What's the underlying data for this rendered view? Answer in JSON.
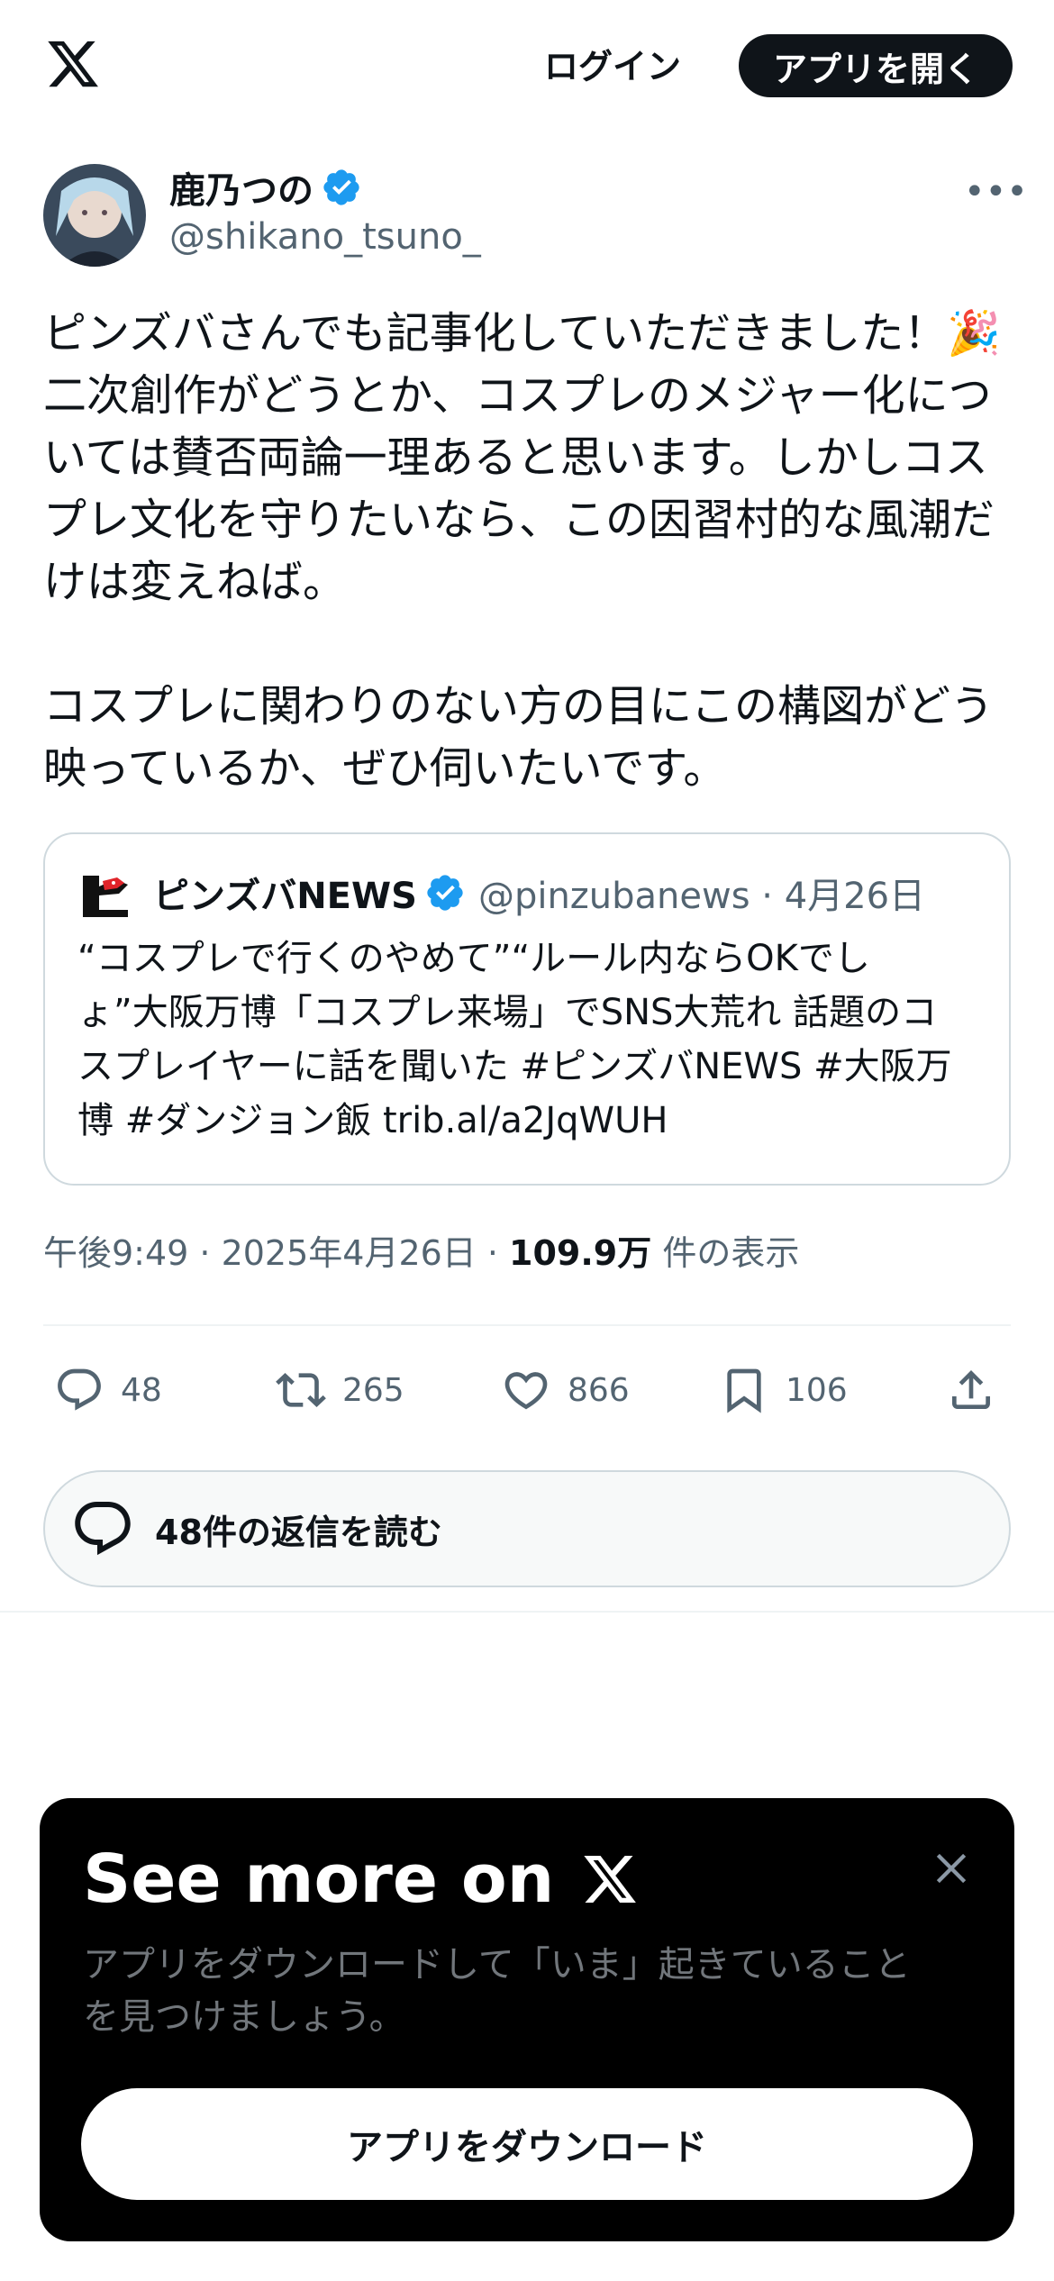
{
  "header": {
    "login_label": "ログイン",
    "open_app_label": "アプリを開く"
  },
  "tweet": {
    "author_name": "鹿乃つの",
    "author_handle": "@shikano_tsuno_",
    "more_label": "•••",
    "text_lines": [
      "ピンズバさんでも記事化していただきました！🎉",
      "二次創作がどうとか、コスプレのメジャー化につ",
      "いては賛否両論一理あると思います。しかしコス",
      "プレ文化を守りたいなら、この因習村的な風潮だ",
      "けは変えねば。",
      "",
      "コスプレに関わりのない方の目にこの構図がどう",
      "映っているか、ぜひ伺いたいです。"
    ],
    "quote": {
      "name": "ピンズバNEWS",
      "handle_date": "@pinzubanews · 4月26日",
      "text_lines": [
        "“コスプレで行くのやめて”“ルール内ならOKでし",
        "ょ”大阪万博「コスプレ来場」でSNS大荒れ 話題のコ",
        "スプレイヤーに話を聞いた #ピンズバNEWS #大阪万",
        "博 #ダンジョン飯 trib.al/a2JqWUH"
      ]
    },
    "meta": {
      "time_date": "午後9:49 · 2025年4月26日 · ",
      "views": "109.9万",
      "views_suffix": " 件の表示"
    },
    "actions": {
      "replies": "48",
      "reposts": "265",
      "likes": "866",
      "bookmarks": "106"
    },
    "read_replies_label": "48件の返信を読む"
  },
  "sheet": {
    "title": "See more on",
    "desc_lines": [
      "アプリをダウンロードして「いま」起きていること",
      "を見つけましょう。"
    ],
    "download_label": "アプリをダウンロード"
  },
  "colors": {
    "text_primary": "#0f1419",
    "text_secondary": "#536471",
    "verified_blue": "#1d9bf0",
    "border": "#cfd9de"
  },
  "icons": {
    "logo": "x-logo-icon",
    "verified": "verified-badge-icon",
    "reply": "reply-icon",
    "repost": "repost-icon",
    "like": "heart-icon",
    "bookmark": "bookmark-icon",
    "share": "share-icon",
    "close": "close-icon"
  }
}
